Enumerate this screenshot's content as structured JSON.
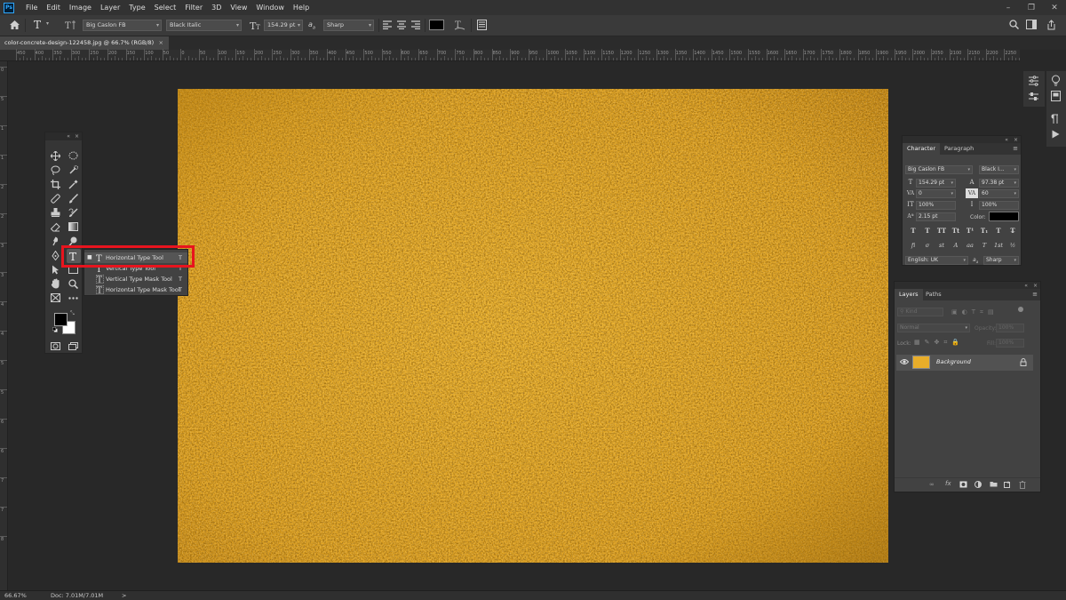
{
  "app": {
    "logo_text": "Ps"
  },
  "menu": [
    "File",
    "Edit",
    "Image",
    "Layer",
    "Type",
    "Select",
    "Filter",
    "3D",
    "View",
    "Window",
    "Help"
  ],
  "window_controls": [
    "–",
    "❐",
    "✕"
  ],
  "options_bar": {
    "tool_glyph": "T",
    "font_family": "Big Caslon FB",
    "font_style": "Black Italic",
    "font_size": "154.29 pt",
    "aa_icon_label": "a",
    "antialias": "Sharp",
    "text_color": "#000000"
  },
  "document_tab": {
    "title": "color-concrete-design-122458.jpg @ 66.7% (RGB/8)",
    "close": "×"
  },
  "ruler_h_labels": [
    "450",
    "400",
    "350",
    "300",
    "250",
    "200",
    "150",
    "100",
    "50",
    "0",
    "50",
    "100",
    "150",
    "200",
    "250",
    "300",
    "350",
    "400",
    "450",
    "500",
    "550",
    "600",
    "650",
    "700",
    "750",
    "800",
    "850",
    "900",
    "950",
    "1000",
    "1050",
    "1100",
    "1150",
    "1200",
    "1250",
    "1300",
    "1350",
    "1400",
    "1450",
    "1500",
    "1550",
    "1600",
    "1650",
    "1700",
    "1750",
    "1800",
    "1850",
    "1900",
    "1950",
    "2000",
    "2050",
    "2100",
    "2150",
    "2200",
    "2250",
    "2300"
  ],
  "ruler_v_labels": [
    "0",
    "5",
    "1",
    "1",
    "2",
    "2",
    "3",
    "3",
    "4",
    "4",
    "5",
    "5",
    "6",
    "6",
    "7",
    "7",
    "8"
  ],
  "flyout": {
    "items": [
      {
        "label": "Horizontal Type Tool",
        "shortcut": "T",
        "selected": true
      },
      {
        "label": "Vertical Type Tool",
        "shortcut": "T"
      },
      {
        "label": "Vertical Type Mask Tool",
        "shortcut": "T"
      },
      {
        "label": "Horizontal Type Mask Tool",
        "shortcut": "T"
      }
    ],
    "highlight_color": "#e8141e"
  },
  "character_panel": {
    "tabs": [
      "Character",
      "Paragraph"
    ],
    "font_family": "Big Caslon FB",
    "font_style": "Black I...",
    "size": "154.29 pt",
    "leading": "97.38 pt",
    "kerning": "0",
    "tracking": "60",
    "vscale": "100%",
    "hscale": "100%",
    "baseline": "2.15 pt",
    "color_label": "Color:",
    "color": "#000000",
    "style_row1": [
      "T",
      "T",
      "TT",
      "Tt",
      "T¹",
      "T₁",
      "T",
      "T̶"
    ],
    "style_row2": [
      "fi",
      "σ",
      "st",
      "A",
      "aa",
      "T",
      "1st",
      "½"
    ],
    "language": "English: UK",
    "aa_icon_label": "a",
    "antialias": "Sharp"
  },
  "layers_panel": {
    "tabs": [
      "Layers",
      "Paths"
    ],
    "filter_label": "Kind",
    "blend_mode": "Normal",
    "opacity_label": "Opacity:",
    "opacity": "100%",
    "lock_label": "Lock:",
    "fill_label": "Fill:",
    "fill": "100%",
    "layers": [
      {
        "name": "Background",
        "visible": true,
        "locked": true,
        "thumb_color": "#e8ad2a"
      }
    ]
  },
  "status_bar": {
    "zoom": "66.67%",
    "doc_info": "Doc: 7.01M/7.01M",
    "arrow": ">"
  },
  "colors": {
    "foreground": "#000000",
    "background": "#ffffff",
    "canvas_texture_base": "#e2a323"
  }
}
